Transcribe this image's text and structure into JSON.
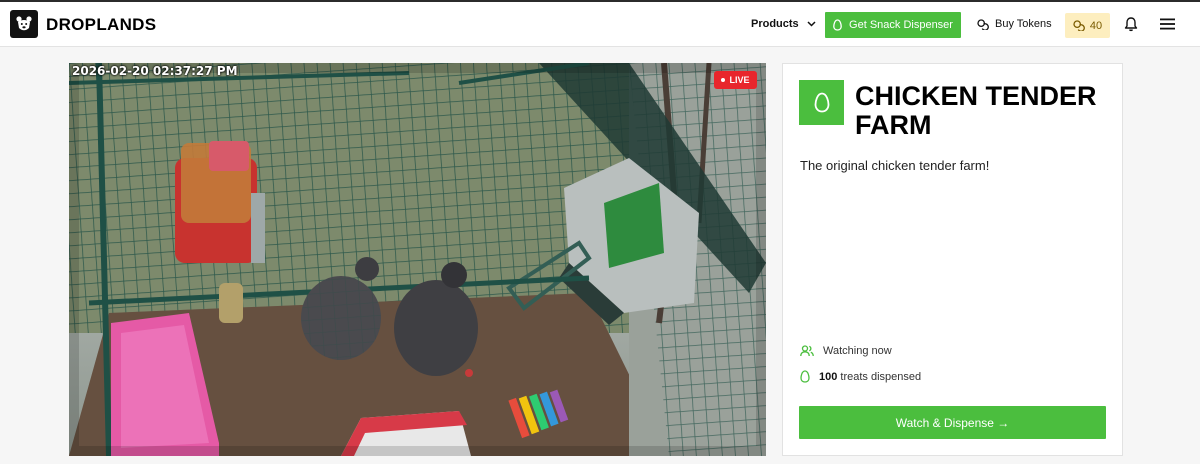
{
  "header": {
    "brand": "DROPLANDS",
    "products_label": "Products",
    "snack_button_label": "Get Snack Dispenser",
    "buy_tokens_label": "Buy Tokens",
    "token_balance": "40"
  },
  "video": {
    "timestamp": "2026-02-20 02:37:27 PM",
    "live_label": "LIVE"
  },
  "farm": {
    "title": "CHICKEN TENDER FARM",
    "description": "The original chicken tender farm!",
    "watching_label": "Watching now",
    "treats_count": "100",
    "treats_label": "treats dispensed",
    "watch_button_label": "Watch & Dispense →"
  },
  "colors": {
    "accent_green": "#4bbe3e",
    "live_red": "#e8262c",
    "token_badge_bg": "#fdeebf"
  },
  "icons": [
    "bear-logo-icon",
    "chevron-down-icon",
    "egg-icon",
    "coins-icon",
    "bell-icon",
    "hamburger-menu-icon",
    "users-icon"
  ]
}
